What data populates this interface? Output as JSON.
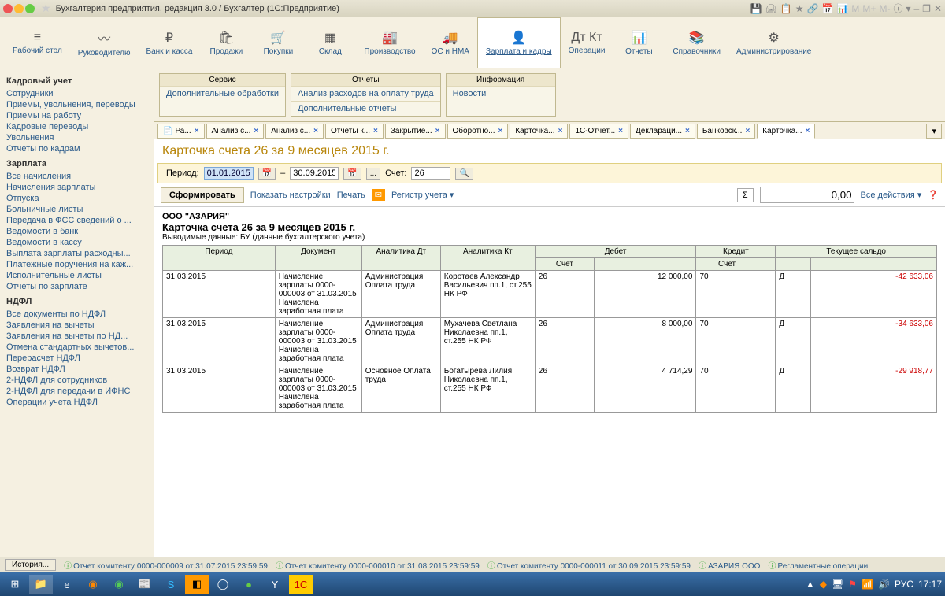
{
  "window": {
    "title": "Бухгалтерия предприятия, редакция 3.0 / Бухгалтер  (1С:Предприятие)"
  },
  "mainnav": [
    {
      "icon": "≡",
      "label": "Рабочий стол"
    },
    {
      "icon": "〰",
      "label": "Руководителю"
    },
    {
      "icon": "₽",
      "label": "Банк и касса"
    },
    {
      "icon": "🛍",
      "label": "Продажи"
    },
    {
      "icon": "🛒",
      "label": "Покупки"
    },
    {
      "icon": "▦",
      "label": "Склад"
    },
    {
      "icon": "🏭",
      "label": "Производство"
    },
    {
      "icon": "🚚",
      "label": "ОС и НМА"
    },
    {
      "icon": "👤",
      "label": "Зарплата и кадры",
      "active": true,
      "under": true
    },
    {
      "icon": "Дт Кт",
      "label": "Операции"
    },
    {
      "icon": "📊",
      "label": "Отчеты"
    },
    {
      "icon": "📚",
      "label": "Справочники"
    },
    {
      "icon": "⚙",
      "label": "Администрирование"
    }
  ],
  "sidebar": {
    "sections": [
      {
        "title": "Кадровый учет",
        "items": [
          "Сотрудники",
          "Приемы, увольнения, переводы",
          "Приемы на работу",
          "Кадровые переводы",
          "Увольнения",
          "Отчеты по кадрам"
        ]
      },
      {
        "title": "Зарплата",
        "items": [
          "Все начисления",
          "Начисления зарплаты",
          "Отпуска",
          "Больничные листы",
          "Передача в ФСС сведений о ...",
          "Ведомости в банк",
          "Ведомости в кассу",
          "Выплата зарплаты расходны...",
          "Платежные поручения на каж...",
          "Исполнительные листы",
          "Отчеты по зарплате"
        ]
      },
      {
        "title": "НДФЛ",
        "items": [
          "Все документы по НДФЛ",
          "Заявления на вычеты",
          "Заявления на вычеты по НД...",
          "Отмена стандартных вычетов...",
          "Перерасчет НДФЛ",
          "Возврат НДФЛ",
          "2-НДФЛ для сотрудников",
          "2-НДФЛ для передачи в ИФНС",
          "Операции учета НДФЛ"
        ]
      }
    ]
  },
  "toolboxes": [
    {
      "title": "Сервис",
      "items": [
        "Дополнительные обработки"
      ]
    },
    {
      "title": "Отчеты",
      "items": [
        "Анализ расходов на оплату труда",
        "Дополнительные отчеты"
      ]
    },
    {
      "title": "Информация",
      "items": [
        "Новости"
      ]
    }
  ],
  "tabs": [
    {
      "label": "Ра...",
      "icon": "📄"
    },
    {
      "label": "Анализ с..."
    },
    {
      "label": "Анализ с..."
    },
    {
      "label": "Отчеты к..."
    },
    {
      "label": "Закрытие..."
    },
    {
      "label": "Оборотно..."
    },
    {
      "label": "Карточка..."
    },
    {
      "label": "1С-Отчет..."
    },
    {
      "label": "Деклараци..."
    },
    {
      "label": "Банковск..."
    },
    {
      "label": "Карточка...",
      "active": true
    }
  ],
  "page": {
    "title": "Карточка счета 26 за 9 месяцев 2015 г.",
    "period_label": "Период:",
    "period_from": "01.01.2015",
    "period_to": "30.09.2015",
    "account_label": "Счет:",
    "account": "26"
  },
  "actions": {
    "form": "Сформировать",
    "settings": "Показать настройки",
    "print": "Печать",
    "register": "Регистр учета ",
    "sum": "0,00",
    "all": "Все действия"
  },
  "report": {
    "org": "ООО \"АЗАРИЯ\"",
    "title": "Карточка счета 26 за 9 месяцев 2015 г.",
    "subtitle": "Выводимые данные:  БУ (данные бухгалтерского учета)",
    "columns": {
      "period": "Период",
      "document": "Документ",
      "analyt_dt": "Аналитика Дт",
      "analyt_kt": "Аналитика Кт",
      "debit": "Дебет",
      "credit": "Кредит",
      "balance": "Текущее сальдо",
      "account": "Счет"
    },
    "rows": [
      {
        "period": "31.03.2015",
        "document": "Начисление зарплаты 0000-000003 от 31.03.2015 Начислена заработная плата",
        "analyt_dt": "Администрация Оплата труда",
        "analyt_kt": "Коротаев Александр Васильевич пп.1, ст.255 НК РФ",
        "debit_acc": "26",
        "debit": "12 000,00",
        "credit_acc": "70",
        "credit": "",
        "bal_sign": "Д",
        "balance": "-42 633,06"
      },
      {
        "period": "31.03.2015",
        "document": "Начисление зарплаты 0000-000003 от 31.03.2015 Начислена заработная плата",
        "analyt_dt": "Администрация Оплата труда",
        "analyt_kt": "Мухачева Светлана Николаевна пп.1, ст.255 НК РФ",
        "debit_acc": "26",
        "debit": "8 000,00",
        "credit_acc": "70",
        "credit": "",
        "bal_sign": "Д",
        "balance": "-34 633,06"
      },
      {
        "period": "31.03.2015",
        "document": "Начисление зарплаты 0000-000003 от 31.03.2015 Начислена заработная плата",
        "analyt_dt": "Основное Оплата труда",
        "analyt_kt": "Богатырёва Лилия Николаевна пп.1, ст.255 НК РФ",
        "debit_acc": "26",
        "debit": "4 714,29",
        "credit_acc": "70",
        "credit": "",
        "bal_sign": "Д",
        "balance": "-29 918,77"
      }
    ]
  },
  "statusbar": {
    "history": "История...",
    "items": [
      "Отчет комитенту 0000-000009 от 31.07.2015 23:59:59",
      "Отчет комитенту 0000-000010 от 31.08.2015 23:59:59",
      "Отчет комитенту 0000-000011 от 30.09.2015 23:59:59",
      "АЗАРИЯ ООО",
      "Регламентные операции"
    ]
  },
  "taskbar": {
    "lang": "РУС",
    "time": "17:17"
  }
}
